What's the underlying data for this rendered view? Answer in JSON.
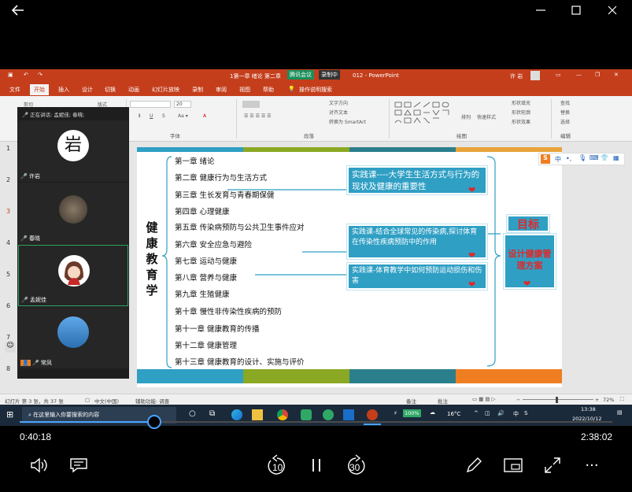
{
  "player": {
    "back_icon": "arrow-left-icon",
    "window_controls": [
      "minimize-icon",
      "maximize-icon",
      "close-icon"
    ],
    "current_time": "0:40:18",
    "total_time": "2:38:02",
    "progress_fraction": 0.227,
    "skip_back_label": "10",
    "skip_forward_label": "30",
    "accent_color": "#4aa3ff"
  },
  "ppt": {
    "title": "1第一章 绪论 第二章",
    "title_suffix": "012  -  PowerPoint",
    "meeting_label": "腾讯会议",
    "recording_label": "录制中",
    "user_name": "许 岩",
    "brand_color": "#c43e1c",
    "tabs": [
      "文件",
      "开始",
      "插入",
      "设计",
      "切换",
      "动画",
      "幻灯片放映",
      "录制",
      "审阅",
      "视图",
      "帮助",
      "操作说明搜索"
    ],
    "active_tab": "开始",
    "ribbon": {
      "clipboard": [
        "剪切",
        "复制"
      ],
      "format_label": "版式",
      "font_group": "字体",
      "paragraph_group": "段落",
      "drawing_group": "绘图",
      "edit_group": "编辑",
      "font_size": "20",
      "text_direction": "文字方向",
      "align_text": "对齐文本",
      "convert_smartart": "转换为 SmartArt",
      "arrange": "排列",
      "quick_styles": "快速样式",
      "shape_fill": "形状填充",
      "shape_outline": "形状轮廓",
      "shape_effects": "形状效果",
      "find": "查找",
      "replace": "替换",
      "select": "选择"
    },
    "speaking_label": "正在讲话: 孟妮佳; 春晓;",
    "participants": [
      {
        "name": "许岩",
        "avatar": "calligraphy-avatar-icon"
      },
      {
        "name": "春晓",
        "avatar": "cat-paw-avatar-icon"
      },
      {
        "name": "孟妮佳",
        "avatar": "cartoon-girl-avatar-icon"
      },
      {
        "name": "常凤",
        "avatar": "sky-avatar-icon"
      }
    ],
    "slide_numbers": [
      "1",
      "2",
      "3",
      "4",
      "5",
      "6",
      "7",
      "8"
    ],
    "slide": {
      "vertical_title": "健康教育学",
      "chapters": [
        "第一章 绪论",
        "第二章 健康行为与生活方式",
        "第三章 生长发育与青春期保健",
        "第四章 心理健康",
        "第五章 传染病预防与公共卫生事件应对",
        "第六章 安全应急与避险",
        "第七章 运动与健康",
        "第八章 营养与健康",
        "第九章 生殖健康",
        "第十章 慢性非传染性疾病的预防",
        "第十一章 健康教育的传播",
        "第十二章 健康管理",
        "第十三章 健康教育的设计、实施与评价"
      ],
      "callouts": [
        "实践课----大学生生活方式与行为的现状及健康的重要性",
        "实践课-结合全球常见的传染病,探讨体育在传染性疾病预防中的作用",
        "实践课-体育教学中如何预防运动损伤和伤害"
      ],
      "goal_label": "目标",
      "goal_text": "设计健康管理方案",
      "ime_brand": "S",
      "ime_mode": "中",
      "colors": {
        "teal": "#2f9fc4",
        "olive": "#8aa823",
        "orange": "#ef7e22",
        "dark_teal": "#2b7f8c",
        "gold": "#e8a33a"
      }
    },
    "status": {
      "slide_info": "幻灯片 第 3 张，共 37 张",
      "language": "中文(中国)",
      "accessibility": "辅助功能: 调查",
      "notes": "备注",
      "comments": "批注",
      "zoom": "72%"
    }
  },
  "taskbar": {
    "search_placeholder": "在这里输入你要搜索的内容",
    "battery": "100%",
    "temperature": "16°C",
    "ime": "中",
    "clock_time": "13:38",
    "clock_date": "2022/10/12"
  }
}
